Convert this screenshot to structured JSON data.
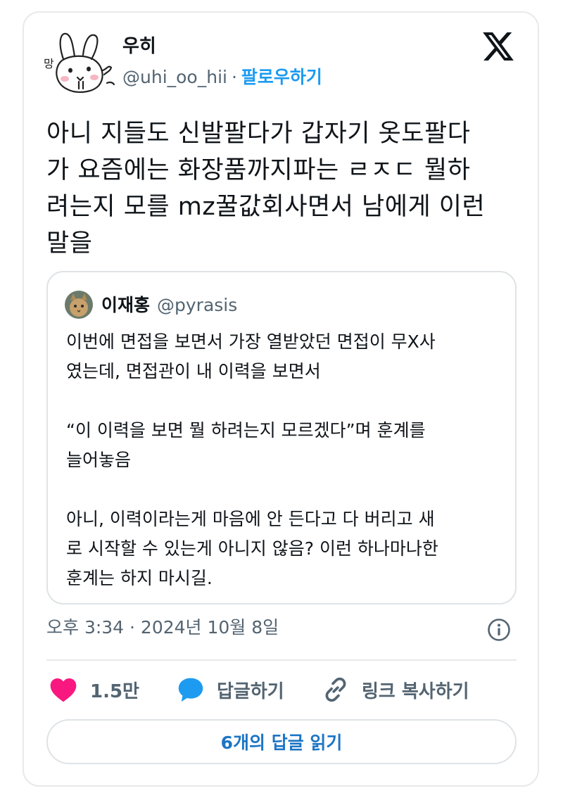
{
  "author": {
    "name": "우히",
    "handle": "@uhi_oo_hii",
    "separator": "·",
    "follow_label": "팔로우하기",
    "avatar_caption": "망"
  },
  "tweet": {
    "text": "아니 지들도 신발팔다가 갑자기 옷도팔다\n가 요즘에는 화장품까지파는 ㄹㅈㄷ 뭘하\n려는지 모를 mz꿀값회사면서 남에게 이런\n말을",
    "timestamp": "오후 3:34 · 2024년 10월 8일"
  },
  "quoted_tweet": {
    "name": "이재홍",
    "handle": "@pyrasis",
    "text": "이번에 면접을 보면서 가장 열받았던 면접이 무X사\n였는데, 면접관이 내 이력을 보면서\n\n“이 이력을 보면 뭘 하려는지 모르겠다”며 훈계를\n늘어놓음\n\n아니, 이력이라는게 마음에 안 든다고 다 버리고 새\n로 시작할 수 있는게 아니지 않음? 이런 하나마나한\n훈계는 하지 마시길."
  },
  "actions": {
    "like_count": "1.5만",
    "reply_label": "답글하기",
    "copy_link_label": "링크 복사하기",
    "read_replies_label": "6개의 답글 읽기"
  },
  "icons": {
    "logo": "x-logo-icon",
    "info": "info-icon",
    "like": "heart-icon",
    "reply": "speech-bubble-icon",
    "link": "link-icon"
  },
  "colors": {
    "accent": "#1d9bf0",
    "like": "#f91880",
    "muted": "#536471",
    "text": "#0f1419",
    "border": "#e7e9eb"
  }
}
